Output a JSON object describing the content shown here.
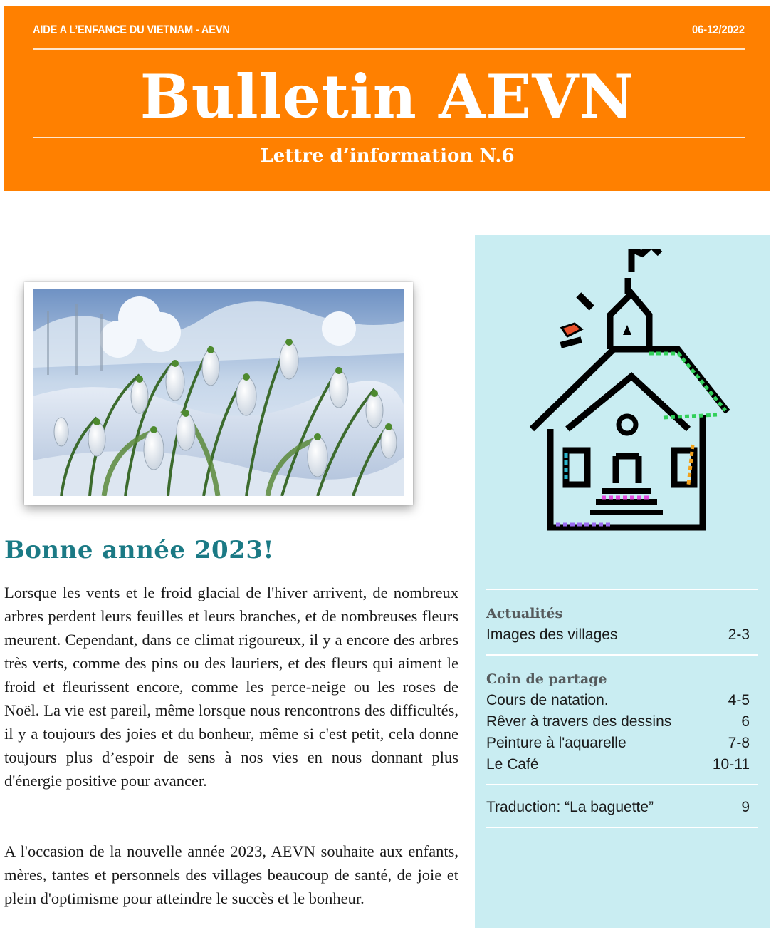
{
  "masthead": {
    "org": "AIDE A L’ENFANCE DU VIETNAM  - AEVN",
    "date": "06-12/2022",
    "title": "Bulletin AEVN",
    "subtitle": "Lettre d’information N.6"
  },
  "colors": {
    "orange": "#ff8000",
    "teal_heading": "#1b7a85",
    "sidebar_bg": "#c9edf2"
  },
  "article": {
    "heading": "Bonne année 2023!",
    "paragraph1": "Lorsque les vents et le froid glacial de l'hiver arrivent, de nombreux arbres perdent leurs feuilles et leurs branches, et de nombreuses fleurs meurent. Cependant, dans ce climat rigoureux, il y a encore des arbres très verts, comme des pins ou des lauriers, et des fleurs qui aiment le froid et fleurissent encore, comme les perce-neige ou les roses de Noël. La vie est pareil, même lorsque nous rencontrons des difficultés, il y a toujours des joies et du bonheur, même si c'est petit, cela donne toujours plus d’espoir de sens à nos vies en nous donnant plus d'énergie positive pour avancer.",
    "paragraph2": "A l'occasion de la nouvelle année 2023, AEVN souhaite aux enfants, mères, tantes et personnels des villages beaucoup de santé, de joie et plein d'optimisme pour atteindre le succès et le bonheur."
  },
  "toc": {
    "sections": [
      {
        "title": "Actualités",
        "items": [
          {
            "label": "Images des villages",
            "page": "2-3"
          }
        ]
      },
      {
        "title": "Coin de partage",
        "items": [
          {
            "label": "Cours de natation.",
            "page": "4-5"
          },
          {
            "label": "Rêver à travers des dessins",
            "page": "6"
          },
          {
            "label": "Peinture à l'aquarelle",
            "page": "7-8"
          },
          {
            "label": "Le Café",
            "page": "10-11"
          }
        ]
      }
    ],
    "extra": {
      "label": "Traduction:  “La baguette”",
      "page": "9"
    }
  },
  "icons": {
    "photo": "snowdrops-photo",
    "house": "school-house-icon"
  }
}
